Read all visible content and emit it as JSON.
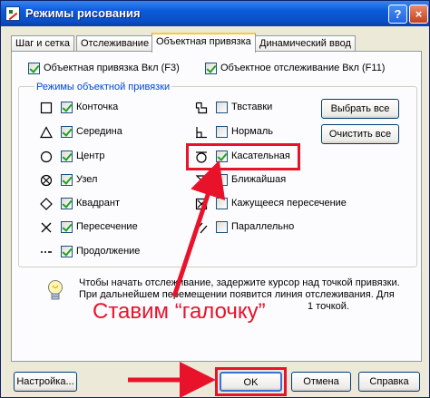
{
  "window": {
    "title": "Режимы рисования",
    "help_label": "?",
    "close_label": "×"
  },
  "tabs": [
    {
      "label": "Шаг и сетка",
      "active": false
    },
    {
      "label": "Отслеживание",
      "active": false
    },
    {
      "label": "Объектная привязка",
      "active": true
    },
    {
      "label": "Динамический ввод",
      "active": false
    }
  ],
  "top_options": {
    "osnap_on": {
      "label": "Объектная привязка Вкл (F3)",
      "checked": true
    },
    "otrack_on": {
      "label": "Объектное отслеживание Вкл (F11)",
      "checked": true
    }
  },
  "group_label": "Режимы объектной привязки",
  "snap_left": [
    {
      "label": "Конточка",
      "icon": "endpoint-icon",
      "checked": true
    },
    {
      "label": "Середина",
      "icon": "midpoint-icon",
      "checked": true
    },
    {
      "label": "Центр",
      "icon": "center-icon",
      "checked": true
    },
    {
      "label": "Узел",
      "icon": "node-icon",
      "checked": true
    },
    {
      "label": "Квадрант",
      "icon": "quadrant-icon",
      "checked": true
    },
    {
      "label": "Пересечение",
      "icon": "intersection-icon",
      "checked": true
    },
    {
      "label": "Продолжение",
      "icon": "extension-icon",
      "checked": true
    }
  ],
  "snap_right": [
    {
      "label": "Твставки",
      "icon": "insertion-icon",
      "checked": false
    },
    {
      "label": "Нормаль",
      "icon": "perpendicular-icon",
      "checked": false
    },
    {
      "label": "Касательная",
      "icon": "tangent-icon",
      "checked": true
    },
    {
      "label": "Ближайшая",
      "icon": "nearest-icon",
      "checked": false
    },
    {
      "label": "Кажущееся пересечение",
      "icon": "apparent-intersection-icon",
      "checked": false
    },
    {
      "label": "Параллельно",
      "icon": "parallel-icon",
      "checked": false
    }
  ],
  "select_all_label": "Выбрать все",
  "clear_all_label": "Очистить все",
  "info_lines": [
    "Чтобы начать отслеживание, задержите курсор над точкой привязки.",
    "При дальнейшем перемещении появится линия отслеживания. Для",
    "1 точкой."
  ],
  "annotation_text": "Ставим “галочку”",
  "buttons": {
    "options": "Настройка...",
    "ok": "OK",
    "cancel": "Отмена",
    "help": "Справка"
  },
  "colors": {
    "annotation": "#e8132b",
    "title_bar": "#0a5ad8",
    "group_label": "#0046d5"
  }
}
